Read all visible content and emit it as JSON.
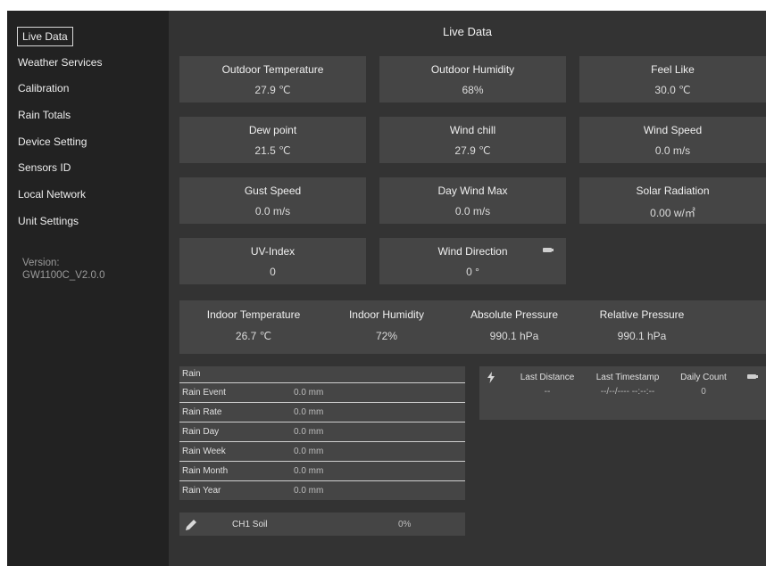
{
  "sidebar": {
    "items": [
      {
        "label": "Live Data"
      },
      {
        "label": "Weather Services"
      },
      {
        "label": "Calibration"
      },
      {
        "label": "Rain Totals"
      },
      {
        "label": "Device Setting"
      },
      {
        "label": "Sensors ID"
      },
      {
        "label": "Local Network"
      },
      {
        "label": "Unit Settings"
      }
    ],
    "version_label": "Version:",
    "version_value": "GW1100C_V2.0.0"
  },
  "main": {
    "title": "Live Data",
    "cards": [
      {
        "label": "Outdoor Temperature",
        "value": "27.9 ℃"
      },
      {
        "label": "Outdoor Humidity",
        "value": "68%"
      },
      {
        "label": "Feel Like",
        "value": "30.0 ℃"
      },
      {
        "label": "Dew point",
        "value": "21.5 ℃"
      },
      {
        "label": "Wind chill",
        "value": "27.9 ℃"
      },
      {
        "label": "Wind Speed",
        "value": "0.0 m/s"
      },
      {
        "label": "Gust Speed",
        "value": "0.0 m/s"
      },
      {
        "label": "Day Wind Max",
        "value": "0.0 m/s"
      },
      {
        "label": "Solar Radiation",
        "value": "0.00 w/㎡"
      },
      {
        "label": "UV-Index",
        "value": "0"
      },
      {
        "label": "Wind Direction",
        "value": "0 °"
      }
    ],
    "indoor": [
      {
        "label": "Indoor Temperature",
        "value": "26.7 ℃"
      },
      {
        "label": "Indoor Humidity",
        "value": "72%"
      },
      {
        "label": "Absolute Pressure",
        "value": "990.1 hPa"
      },
      {
        "label": "Relative Pressure",
        "value": "990.1 hPa"
      }
    ],
    "rain": {
      "header": "Rain",
      "rows": [
        {
          "label": "Rain Event",
          "value": "0.0 mm"
        },
        {
          "label": "Rain Rate",
          "value": "0.0 mm"
        },
        {
          "label": "Rain Day",
          "value": "0.0 mm"
        },
        {
          "label": "Rain Week",
          "value": "0.0 mm"
        },
        {
          "label": "Rain Month",
          "value": "0.0 mm"
        },
        {
          "label": "Rain Year",
          "value": "0.0 mm"
        }
      ]
    },
    "lightning": {
      "last_distance_label": "Last Distance",
      "last_distance_value": "--",
      "last_timestamp_label": "Last Timestamp",
      "last_timestamp_value": "--/--/---- --:--:--",
      "daily_count_label": "Daily Count",
      "daily_count_value": "0"
    },
    "soil": {
      "label": "CH1 Soil",
      "value": "0%"
    }
  },
  "colors": {
    "sidebar_bg": "#222222",
    "main_bg": "#333333",
    "card_bg": "#454545"
  }
}
